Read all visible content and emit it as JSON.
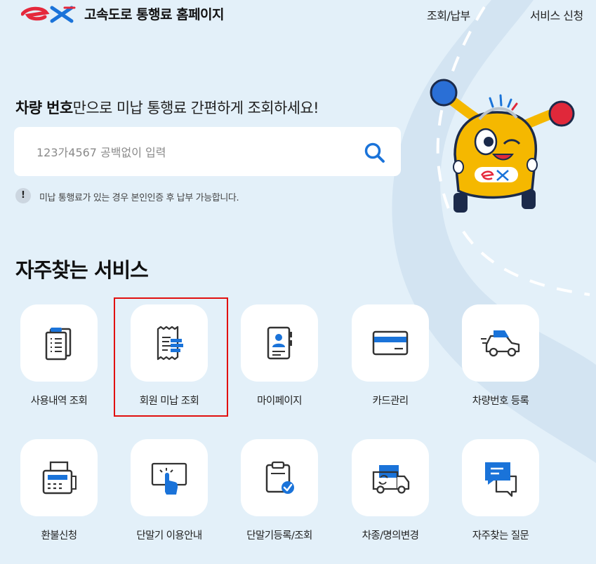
{
  "header": {
    "logo_alt": "ex",
    "site_title": "고속도로 통행료 홈페이지",
    "nav": [
      "조회/납부",
      "서비스 신청"
    ]
  },
  "search": {
    "headline_bold": "차량 번호",
    "headline_rest": "만으로 미납 통행료 간편하게 조회하세요!",
    "placeholder": "123가4567 공백없이 입력",
    "value": "",
    "notice": "미납 통행료가 있는 경우 본인인증 후 납부 가능합니다."
  },
  "section": {
    "title": "자주찾는 서비스"
  },
  "services": [
    {
      "label": "사용내역 조회",
      "icon": "document-list-icon"
    },
    {
      "label": "회원 미납 조회",
      "icon": "receipt-icon"
    },
    {
      "label": "마이페이지",
      "icon": "profile-document-icon"
    },
    {
      "label": "카드관리",
      "icon": "credit-card-icon"
    },
    {
      "label": "차량번호 등록",
      "icon": "car-icon"
    },
    {
      "label": "환불신청",
      "icon": "fax-machine-icon"
    },
    {
      "label": "단말기 이용안내",
      "icon": "touch-terminal-icon"
    },
    {
      "label": "단말기등록/조회",
      "icon": "clipboard-check-icon"
    },
    {
      "label": "차종/명의변경",
      "icon": "truck-exchange-icon"
    },
    {
      "label": "자주찾는 질문",
      "icon": "chat-bubbles-icon"
    }
  ],
  "colors": {
    "accent_blue": "#1a73d9",
    "brand_red": "#e5283c",
    "background": "#e3f0f9",
    "highlight_border": "#e10f0f"
  }
}
